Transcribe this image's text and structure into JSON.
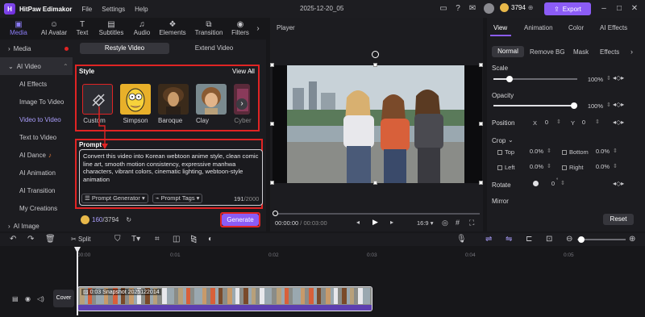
{
  "app": {
    "name": "HitPaw Edimakor",
    "menus": [
      "File",
      "Settings",
      "Help"
    ],
    "doc_title": "2025-12-20_05",
    "credits": "3794",
    "export_label": "Export"
  },
  "tabs": [
    {
      "label": "Media",
      "icon": "media-icon"
    },
    {
      "label": "AI Avatar",
      "icon": "ai-avatar-icon"
    },
    {
      "label": "Text",
      "icon": "text-icon"
    },
    {
      "label": "Subtitles",
      "icon": "subtitles-icon"
    },
    {
      "label": "Audio",
      "icon": "audio-icon"
    },
    {
      "label": "Elements",
      "icon": "elements-icon"
    },
    {
      "label": "Transition",
      "icon": "transition-icon"
    },
    {
      "label": "Filters",
      "icon": "filters-icon"
    }
  ],
  "sidenav": {
    "media": "Media",
    "ai_video": "AI Video",
    "items": [
      "AI Effects",
      "Image To Video",
      "Video to Video",
      "Text to Video",
      "AI Dance",
      "AI Animation",
      "AI Transition",
      "My Creations"
    ],
    "ai_image": "AI Image"
  },
  "restyle": {
    "tab_restyle": "Restyle Video",
    "tab_extend": "Extend Video",
    "style_heading": "Style",
    "view_all": "View All",
    "styles": [
      "Custom",
      "Simpson",
      "Baroque",
      "Clay",
      "Cyber"
    ],
    "prompt_heading": "Prompt",
    "prompt_text": "Convert this video into Korean webtoon anime style, clean comic line art, smooth motion consistency, expressive manhwa characters, vibrant colors, cinematic lighting, webtoon-style animation",
    "prompt_generator": "Prompt Generator",
    "prompt_tags": "Prompt Tags",
    "char_count": "191",
    "char_max": "/2000",
    "cost": "160",
    "balance": "/3794",
    "generate": "Generate"
  },
  "player": {
    "label": "Player",
    "time_current": "00:00:00",
    "time_total": "/ 00:03:00",
    "aspect": "16:9"
  },
  "right_panel": {
    "tabs": [
      "View",
      "Animation",
      "Color",
      "AI Effects"
    ],
    "subtabs": [
      "Normal",
      "Remove BG",
      "Mask",
      "Effects"
    ],
    "scale_label": "Scale",
    "scale_value": "100%",
    "scale_level": 1.0,
    "opacity_label": "Opacity",
    "opacity_value": "100%",
    "opacity_level": 1.0,
    "position_label": "Position",
    "pos_x_label": "X",
    "pos_x": "0",
    "pos_y_label": "Y",
    "pos_y": "0",
    "crop_label": "Crop",
    "crop_top_label": "Top",
    "crop_top": "0.0%",
    "crop_bottom_label": "Bottom",
    "crop_bottom": "0.0%",
    "crop_left_label": "Left",
    "crop_left": "0.0%",
    "crop_right_label": "Right",
    "crop_right": "0.0%",
    "rotate_label": "Rotate",
    "rotate_value": "0",
    "mirror_label": "Mirror",
    "reset": "Reset"
  },
  "timeline": {
    "split_label": "Split",
    "ruler": [
      "00:00",
      "0:01",
      "0:02",
      "0:03",
      "0:04",
      "0:05"
    ],
    "cover_label": "Cover",
    "clip_label": "0:03 Snapshot 2025122014"
  },
  "colors": {
    "accent": "#8b5cf6",
    "highlight_box": "#e02424"
  }
}
